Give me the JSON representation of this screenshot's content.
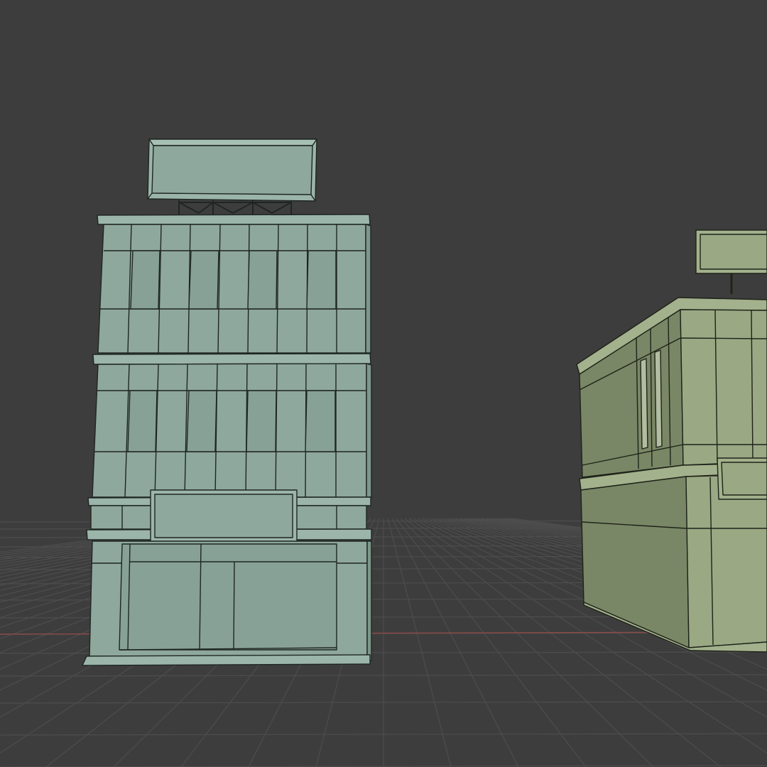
{
  "viewport": {
    "background_color": "#3d3d3d",
    "grid_color": "#4d4d4d",
    "x_axis_color": "#8a4a4a"
  },
  "objects": [
    {
      "name": "building-left",
      "kind": "mesh",
      "shading": "solid",
      "color": "#8fa89d",
      "shadow_color": "#7e968b",
      "edge_color": "#1f2623"
    },
    {
      "name": "building-right",
      "kind": "mesh",
      "shading": "solid",
      "color": "#9aa884",
      "shadow_color": "#7a8766",
      "edge_color": "#1f2319"
    }
  ]
}
